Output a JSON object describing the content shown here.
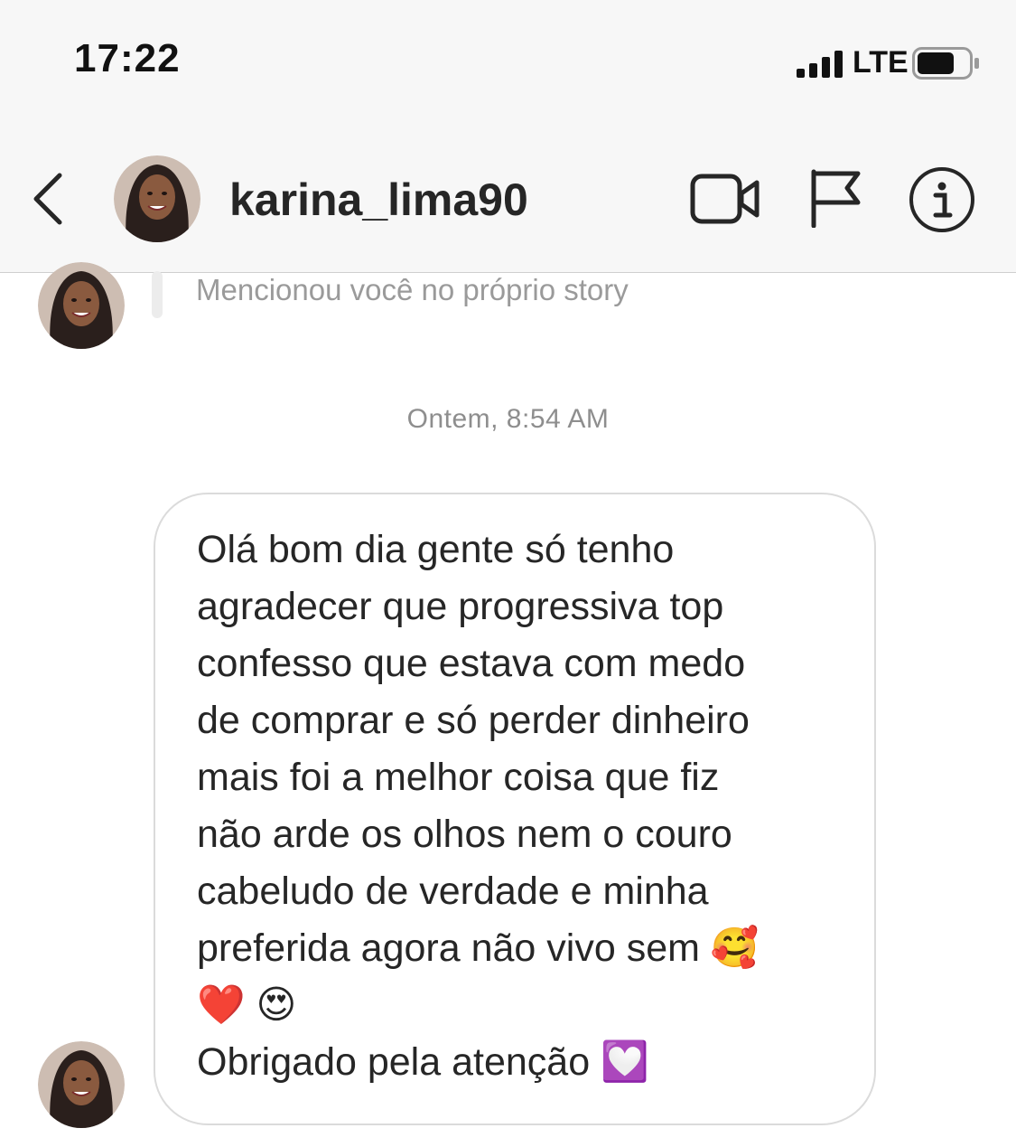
{
  "status_bar": {
    "time": "17:22",
    "network": "LTE",
    "icons": [
      "signal-icon",
      "battery-icon"
    ]
  },
  "header": {
    "username": "karina_lima90",
    "icons": [
      "back-icon",
      "video-call-icon",
      "flag-icon",
      "info-icon"
    ]
  },
  "story_mention": {
    "text": "Mencionou você no próprio story"
  },
  "timestamp": "Ontem, 8:54 AM",
  "message": {
    "lines": [
      "Olá bom dia gente só tenho",
      "agradecer que progressiva top",
      "confesso que estava com medo",
      "de comprar e só perder dinheiro",
      "mais foi a melhor coisa que fiz",
      "não arde os olhos nem o couro",
      "cabeludo de verdade e minha",
      "preferida agora não vivo sem 🥰",
      "❤️ 😍",
      "Obrigado pela atenção 💟"
    ]
  },
  "colors": {
    "header_bg": "#f7f7f7",
    "text": "#262626",
    "muted": "#8e8e8e",
    "bubble_border": "#dbdbdb"
  }
}
